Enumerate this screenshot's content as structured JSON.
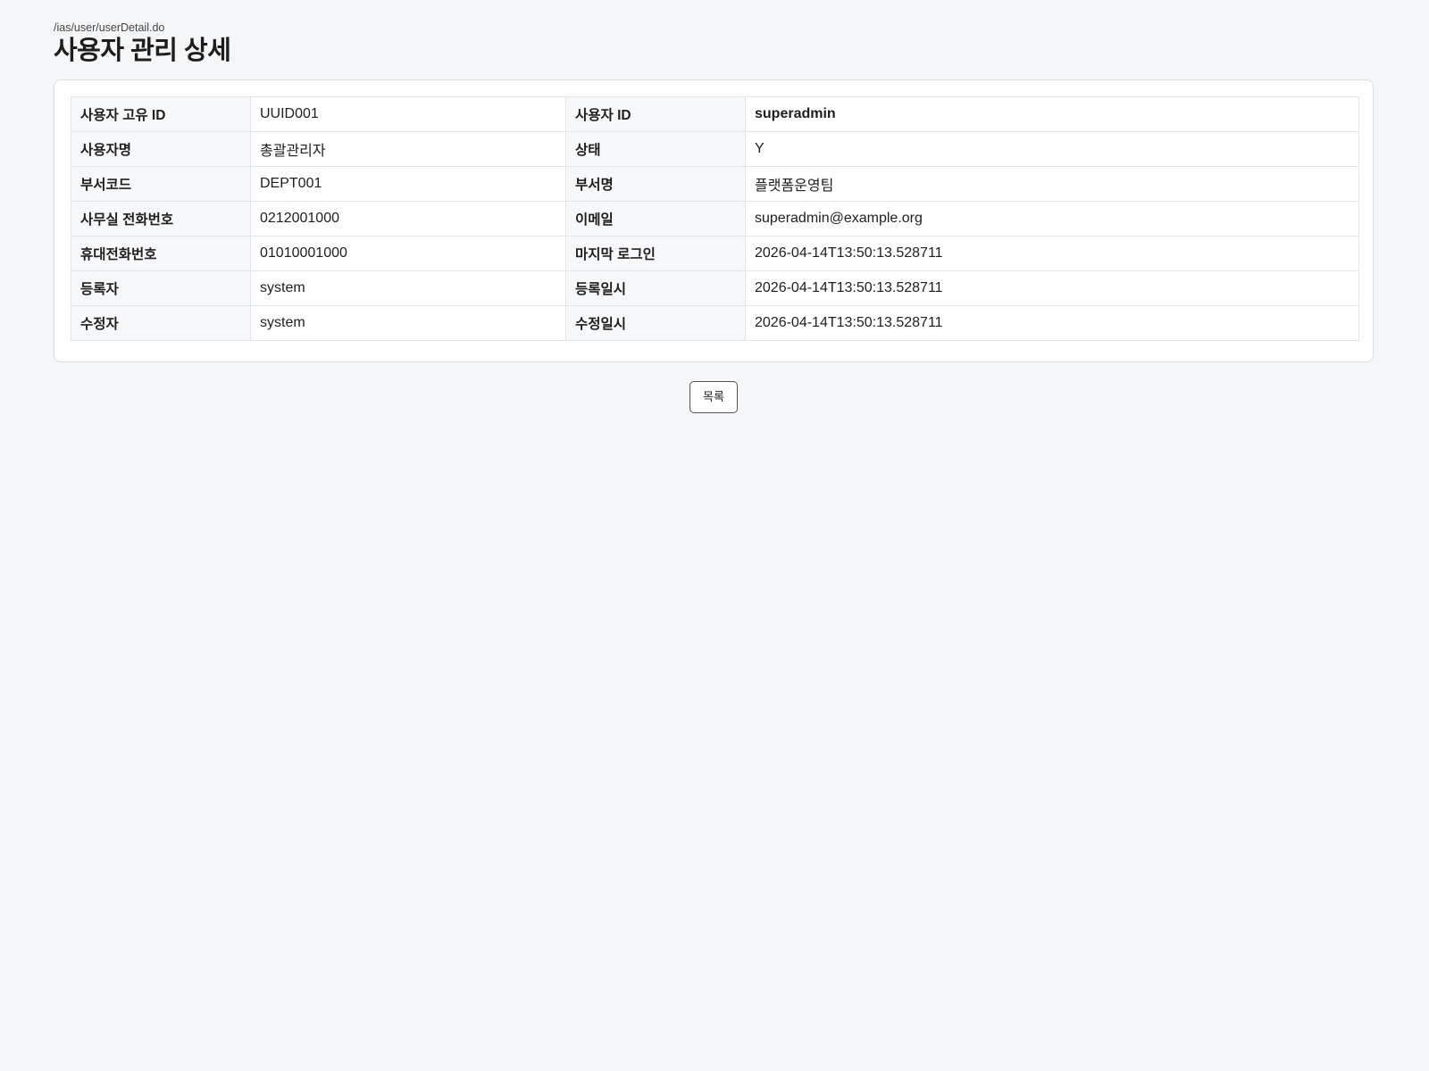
{
  "header": {
    "path": "/ias/user/userDetail.do",
    "title": "사용자 관리 상세"
  },
  "detail": {
    "rows": [
      {
        "label1": "사용자 고유 ID",
        "value1": "UUID001",
        "label2": "사용자 ID",
        "value2": "superadmin"
      },
      {
        "label1": "사용자명",
        "value1": "총괄관리자",
        "label2": "상태",
        "value2": "Y"
      },
      {
        "label1": "부서코드",
        "value1": "DEPT001",
        "label2": "부서명",
        "value2": "플랫폼운영팀"
      },
      {
        "label1": "사무실 전화번호",
        "value1": "0212001000",
        "label2": "이메일",
        "value2": "superadmin@example.org"
      },
      {
        "label1": "휴대전화번호",
        "value1": "01010001000",
        "label2": "마지막 로그인",
        "value2": "2026-04-14T13:50:13.528711"
      },
      {
        "label1": "등록자",
        "value1": "system",
        "label2": "등록일시",
        "value2": "2026-04-14T13:50:13.528711"
      },
      {
        "label1": "수정자",
        "value1": "system",
        "label2": "수정일시",
        "value2": "2026-04-14T13:50:13.528711"
      }
    ]
  },
  "actions": {
    "list_label": "목록"
  }
}
